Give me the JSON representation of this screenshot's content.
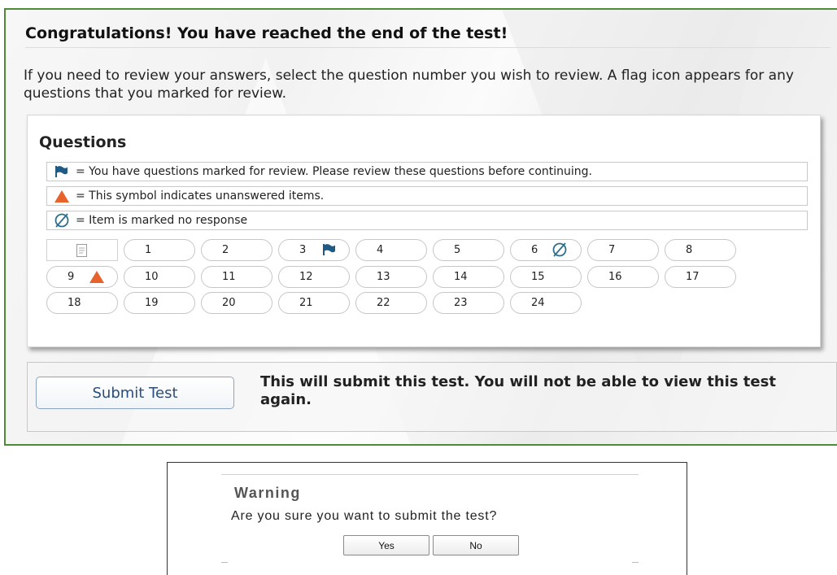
{
  "header": {
    "title": "Congratulations! You have reached the end of the test!",
    "instructions": "If you need to review your answers, select the question number you wish to review. A flag icon appears for any questions that you marked for review."
  },
  "questions_panel": {
    "heading": "Questions",
    "legend": {
      "flag": "= You have questions marked for review. Please review these questions before continuing.",
      "unanswered": "= This symbol indicates unanswered items.",
      "no_response": "= Item is marked no response"
    },
    "review_icon": "document-icon",
    "items": [
      {
        "number": "1",
        "mark": ""
      },
      {
        "number": "2",
        "mark": ""
      },
      {
        "number": "3",
        "mark": "flag"
      },
      {
        "number": "4",
        "mark": ""
      },
      {
        "number": "5",
        "mark": ""
      },
      {
        "number": "6",
        "mark": "no-response"
      },
      {
        "number": "7",
        "mark": ""
      },
      {
        "number": "8",
        "mark": ""
      },
      {
        "number": "9",
        "mark": "unanswered"
      },
      {
        "number": "10",
        "mark": ""
      },
      {
        "number": "11",
        "mark": ""
      },
      {
        "number": "12",
        "mark": ""
      },
      {
        "number": "13",
        "mark": ""
      },
      {
        "number": "14",
        "mark": ""
      },
      {
        "number": "15",
        "mark": ""
      },
      {
        "number": "16",
        "mark": ""
      },
      {
        "number": "17",
        "mark": ""
      },
      {
        "number": "18",
        "mark": ""
      },
      {
        "number": "19",
        "mark": ""
      },
      {
        "number": "20",
        "mark": ""
      },
      {
        "number": "21",
        "mark": ""
      },
      {
        "number": "22",
        "mark": ""
      },
      {
        "number": "23",
        "mark": ""
      },
      {
        "number": "24",
        "mark": ""
      }
    ]
  },
  "submit": {
    "button_label": "Submit Test",
    "note": "This will submit this test. You will not be able to view this test again."
  },
  "dialog": {
    "title": "Warning",
    "message": "Are you sure you want to submit the test?",
    "yes_label": "Yes",
    "no_label": "No"
  },
  "colors": {
    "frame_border": "#4e8a3a",
    "flag": "#1f5a85",
    "unanswered": "#e8632b",
    "no_response": "#2e6f8e",
    "submit_text": "#2b4d77"
  }
}
